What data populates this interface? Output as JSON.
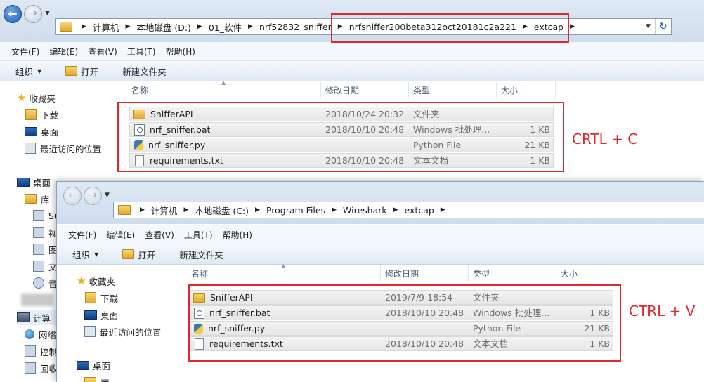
{
  "window1": {
    "breadcrumbs": [
      "计算机",
      "本地磁盘 (D:)",
      "01_软件",
      "nrf52832_sniffer",
      "nrfsniffer200beta312oct20181c2a221",
      "extcap"
    ],
    "menu": [
      "文件(F)",
      "编辑(E)",
      "查看(V)",
      "工具(T)",
      "帮助(H)"
    ],
    "toolbar": {
      "organize": "组织",
      "open": "打开",
      "new_folder": "新建文件夹"
    },
    "nav": [
      {
        "label": "收藏夹",
        "icon": "star-icon"
      },
      {
        "label": "下载",
        "icon": "downloads-folder-icon"
      },
      {
        "label": "桌面",
        "icon": "desktop-icon"
      },
      {
        "label": "最近访问的位置",
        "icon": "recent-places-icon"
      },
      {
        "label": "桌面",
        "icon": "desktop-icon"
      },
      {
        "label": "库",
        "icon": "library-icon"
      },
      {
        "label": "Su",
        "icon": "library-item-icon"
      },
      {
        "label": "视",
        "icon": "videos-icon"
      },
      {
        "label": "图",
        "icon": "pictures-icon"
      },
      {
        "label": "文",
        "icon": "documents-icon"
      },
      {
        "label": "音",
        "icon": "music-icon"
      },
      {
        "label": "计算",
        "icon": "computer-icon"
      },
      {
        "label": "网络",
        "icon": "network-icon"
      },
      {
        "label": "控制",
        "icon": "control-panel-icon"
      },
      {
        "label": "回收",
        "icon": "recycle-bin-icon"
      }
    ],
    "columns": [
      "名称",
      "修改日期",
      "类型",
      "大小"
    ],
    "files": [
      {
        "name": "SnifferAPI",
        "date": "2018/10/24 20:32",
        "type": "文件夹",
        "size": "",
        "icon": "folder-icon"
      },
      {
        "name": "nrf_sniffer.bat",
        "date": "2018/10/10 20:48",
        "type": "Windows 批处理...",
        "size": "1 KB",
        "icon": "batch-file-icon"
      },
      {
        "name": "nrf_sniffer.py",
        "date": "",
        "type": "Python File",
        "size": "21 KB",
        "icon": "python-file-icon"
      },
      {
        "name": "requirements.txt",
        "date": "2018/10/10 20:48",
        "type": "文本文档",
        "size": "1 KB",
        "icon": "text-file-icon"
      }
    ]
  },
  "window2": {
    "breadcrumbs": [
      "计算机",
      "本地磁盘 (C:)",
      "Program Files",
      "Wireshark",
      "extcap"
    ],
    "menu": [
      "文件(F)",
      "编辑(E)",
      "查看(V)",
      "工具(T)",
      "帮助(H)"
    ],
    "toolbar": {
      "organize": "组织",
      "open": "打开",
      "new_folder": "新建文件夹"
    },
    "nav": [
      {
        "label": "收藏夹",
        "icon": "star-icon"
      },
      {
        "label": "下载",
        "icon": "downloads-folder-icon"
      },
      {
        "label": "桌面",
        "icon": "desktop-icon"
      },
      {
        "label": "最近访问的位置",
        "icon": "recent-places-icon"
      },
      {
        "label": "桌面",
        "icon": "desktop-icon"
      },
      {
        "label": "库",
        "icon": "library-icon"
      }
    ],
    "columns": [
      "名称",
      "修改日期",
      "类型",
      "大小"
    ],
    "files": [
      {
        "name": "SnifferAPI",
        "date": "2019/7/9 18:54",
        "type": "文件夹",
        "size": "",
        "icon": "folder-icon"
      },
      {
        "name": "nrf_sniffer.bat",
        "date": "2018/10/10 20:48",
        "type": "Windows 批处理...",
        "size": "1 KB",
        "icon": "batch-file-icon"
      },
      {
        "name": "nrf_sniffer.py",
        "date": "",
        "type": "Python File",
        "size": "21 KB",
        "icon": "python-file-icon"
      },
      {
        "name": "requirements.txt",
        "date": "2018/10/10 20:48",
        "type": "文本文档",
        "size": "1 KB",
        "icon": "text-file-icon"
      }
    ]
  },
  "annotations": {
    "copy": "CRTL + C",
    "paste": "CTRL + V"
  },
  "colors": {
    "annotation_red": "#e0292e",
    "toolbar_blue": "#dfe9f5"
  }
}
